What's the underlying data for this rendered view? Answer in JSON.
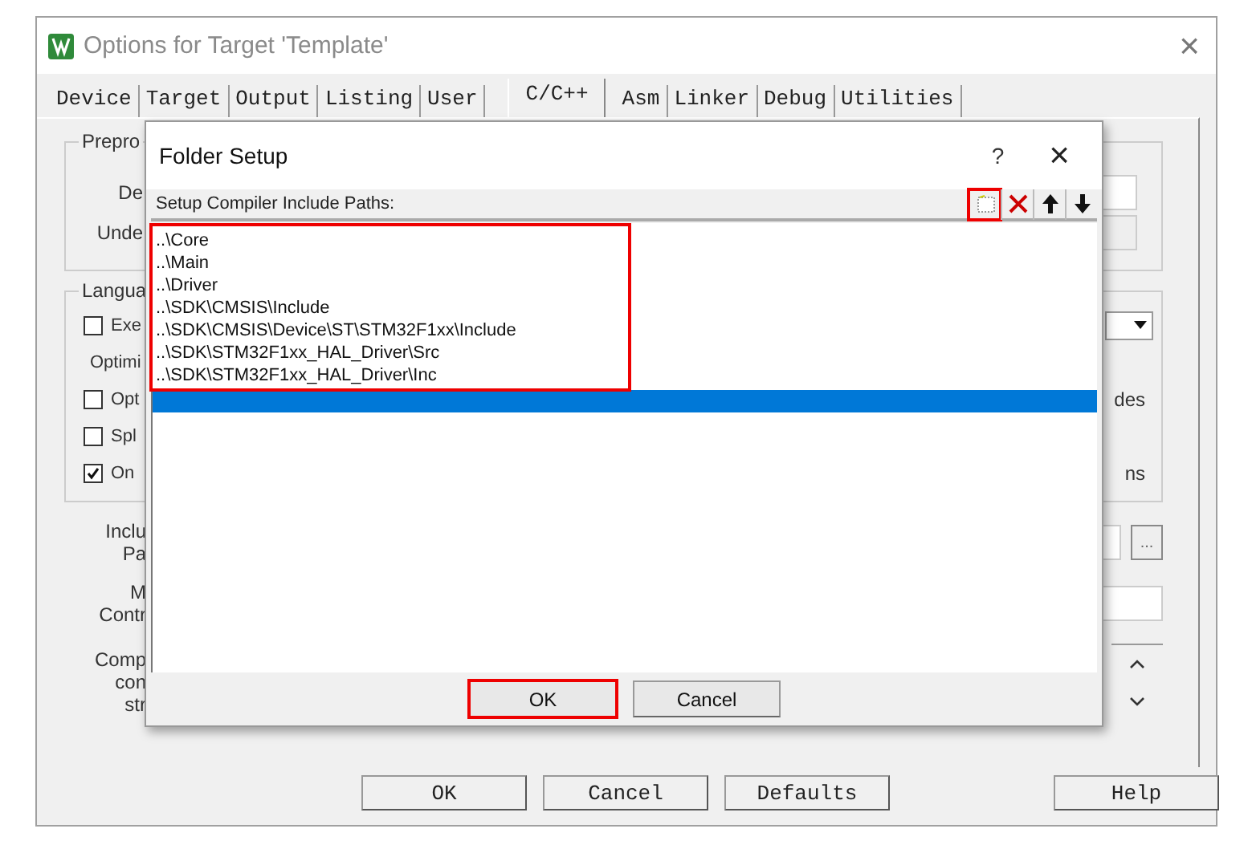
{
  "window": {
    "title": "Options for Target 'Template'",
    "close": "×"
  },
  "tabs": [
    {
      "label": "Device",
      "selected": false
    },
    {
      "label": "Target",
      "selected": false
    },
    {
      "label": "Output",
      "selected": false
    },
    {
      "label": "Listing",
      "selected": false
    },
    {
      "label": "User",
      "selected": false
    },
    {
      "label": "C/C++",
      "selected": true
    },
    {
      "label": "Asm",
      "selected": false
    },
    {
      "label": "Linker",
      "selected": false
    },
    {
      "label": "Debug",
      "selected": false
    },
    {
      "label": "Utilities",
      "selected": false
    }
  ],
  "preprocessor_group": {
    "title": "Prepro",
    "rows": [
      "De",
      "Unde"
    ]
  },
  "language_group": {
    "title": "Langua",
    "optimization_label": "Optimi",
    "checkboxes": [
      {
        "label": "Exe",
        "checked": false
      },
      {
        "label": "Opt",
        "checked": false
      },
      {
        "label": "Spl",
        "checked": false
      },
      {
        "label": "On",
        "checked": true
      }
    ],
    "right_texts": [
      "des",
      "ns"
    ]
  },
  "bottom_rows": [
    {
      "kind": "browse",
      "labels": [
        "Inclu",
        "Pa"
      ],
      "button": "..."
    },
    {
      "kind": "field",
      "labels": [
        "M",
        "Contr"
      ]
    },
    {
      "kind": "scroll",
      "labels": [
        "Comp",
        "con",
        "str"
      ]
    }
  ],
  "footer_buttons": [
    {
      "label": "OK"
    },
    {
      "label": "Cancel"
    },
    {
      "label": "Defaults"
    },
    {
      "label": "Help",
      "kind": "right"
    }
  ],
  "dialog": {
    "title": "Folder Setup",
    "help": "?",
    "close": "×",
    "header": "Setup Compiler Include Paths:",
    "toolbar": [
      {
        "kind": "new",
        "highlighted": true
      },
      {
        "kind": "delete",
        "highlighted": false
      },
      {
        "kind": "up",
        "highlighted": false
      },
      {
        "kind": "down",
        "highlighted": false
      }
    ],
    "paths_highlighted": true,
    "paths": [
      {
        "text": "..\\Core",
        "selected": false
      },
      {
        "text": "..\\Main",
        "selected": false
      },
      {
        "text": "..\\Driver",
        "selected": false
      },
      {
        "text": "..\\SDK\\CMSIS\\Include",
        "selected": false
      },
      {
        "text": "..\\SDK\\CMSIS\\Device\\ST\\STM32F1xx\\Include",
        "selected": false
      },
      {
        "text": "..\\SDK\\STM32F1xx_HAL_Driver\\Src",
        "selected": false
      },
      {
        "text": "..\\SDK\\STM32F1xx_HAL_Driver\\Inc",
        "selected": false
      }
    ],
    "new_entry": {
      "selected": true
    },
    "buttons": [
      {
        "label": "OK",
        "highlighted": true
      },
      {
        "label": "Cancel",
        "highlighted": false
      }
    ]
  }
}
